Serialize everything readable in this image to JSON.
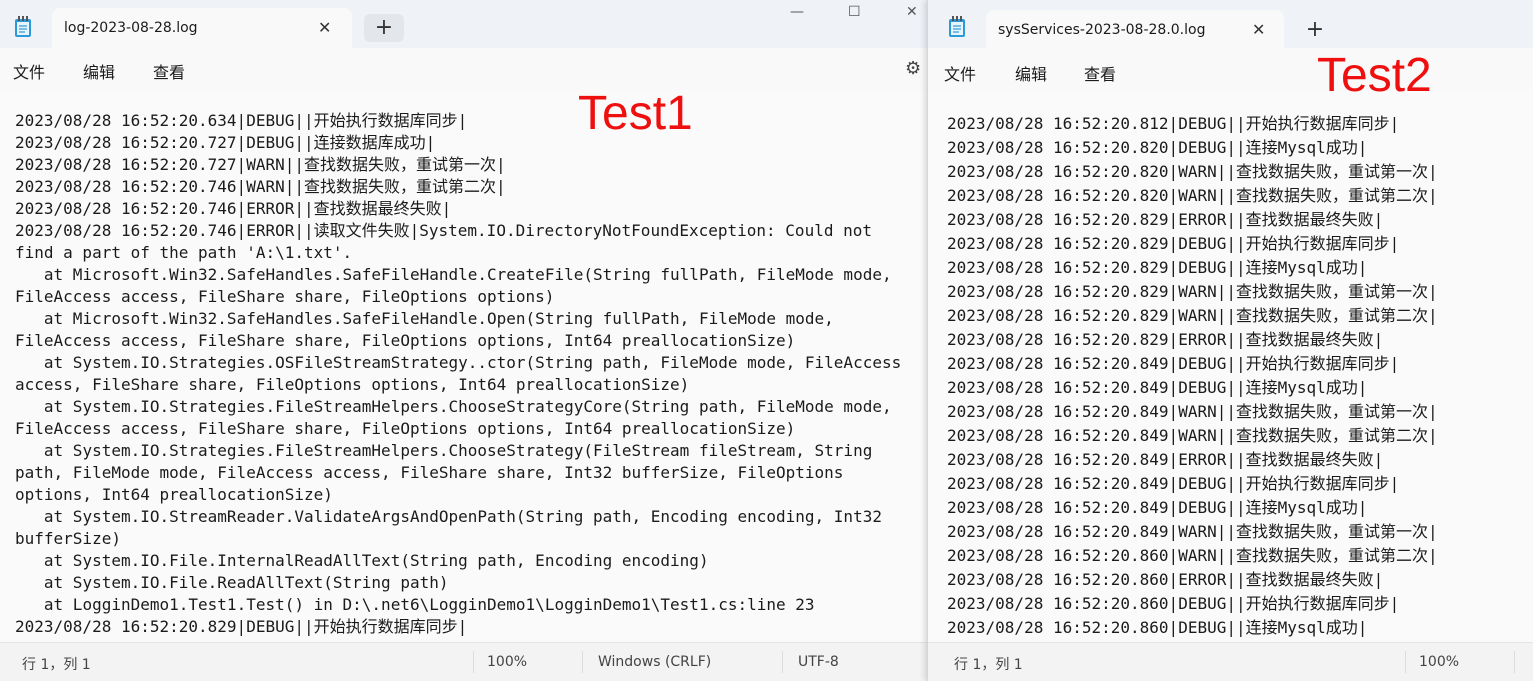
{
  "left_window": {
    "tab_title": "log-2023-08-28.log",
    "new_tab_label": "+",
    "close_tab_label": "✕",
    "caption": {
      "minimize": "—",
      "maximize": "☐",
      "close": "✕"
    },
    "menu": {
      "file": "文件",
      "edit": "编辑",
      "view": "查看"
    },
    "settings_icon": "⚙",
    "lines": [
      "2023/08/28 16:52:20.634|DEBUG||开始执行数据库同步|",
      "2023/08/28 16:52:20.727|DEBUG||连接数据库成功|",
      "2023/08/28 16:52:20.727|WARN||查找数据失败，重试第一次|",
      "2023/08/28 16:52:20.746|WARN||查找数据失败，重试第二次|",
      "2023/08/28 16:52:20.746|ERROR||查找数据最终失败|",
      "2023/08/28 16:52:20.746|ERROR||读取文件失败|System.IO.DirectoryNotFoundException: Could not find a part of the path 'A:\\1.txt'.",
      "   at Microsoft.Win32.SafeHandles.SafeFileHandle.CreateFile(String fullPath, FileMode mode, FileAccess access, FileShare share, FileOptions options)",
      "   at Microsoft.Win32.SafeHandles.SafeFileHandle.Open(String fullPath, FileMode mode, FileAccess access, FileShare share, FileOptions options, Int64 preallocationSize)",
      "   at System.IO.Strategies.OSFileStreamStrategy..ctor(String path, FileMode mode, FileAccess access, FileShare share, FileOptions options, Int64 preallocationSize)",
      "   at System.IO.Strategies.FileStreamHelpers.ChooseStrategyCore(String path, FileMode mode, FileAccess access, FileShare share, FileOptions options, Int64 preallocationSize)",
      "   at System.IO.Strategies.FileStreamHelpers.ChooseStrategy(FileStream fileStream, String path, FileMode mode, FileAccess access, FileShare share, Int32 bufferSize, FileOptions options, Int64 preallocationSize)",
      "   at System.IO.StreamReader.ValidateArgsAndOpenPath(String path, Encoding encoding, Int32 bufferSize)",
      "   at System.IO.File.InternalReadAllText(String path, Encoding encoding)",
      "   at System.IO.File.ReadAllText(String path)",
      "   at LogginDemo1.Test1.Test() in D:\\.net6\\LogginDemo1\\LogginDemo1\\Test1.cs:line 23",
      "2023/08/28 16:52:20.829|DEBUG||开始执行数据库同步|"
    ],
    "status": {
      "position": "行 1，列 1",
      "zoom": "100%",
      "line_ending": "Windows (CRLF)",
      "encoding": "UTF-8"
    },
    "annotation": "Test1"
  },
  "right_window": {
    "tab_title": "sysServices-2023-08-28.0.log",
    "new_tab_label": "+",
    "close_tab_label": "✕",
    "menu": {
      "file": "文件",
      "edit": "编辑",
      "view": "查看"
    },
    "lines": [
      "2023/08/28 16:52:20.812|DEBUG||开始执行数据库同步|",
      "2023/08/28 16:52:20.820|DEBUG||连接Mysql成功|",
      "2023/08/28 16:52:20.820|WARN||查找数据失败，重试第一次|",
      "2023/08/28 16:52:20.820|WARN||查找数据失败，重试第二次|",
      "2023/08/28 16:52:20.829|ERROR||查找数据最终失败|",
      "2023/08/28 16:52:20.829|DEBUG||开始执行数据库同步|",
      "2023/08/28 16:52:20.829|DEBUG||连接Mysql成功|",
      "2023/08/28 16:52:20.829|WARN||查找数据失败，重试第一次|",
      "2023/08/28 16:52:20.829|WARN||查找数据失败，重试第二次|",
      "2023/08/28 16:52:20.829|ERROR||查找数据最终失败|",
      "2023/08/28 16:52:20.849|DEBUG||开始执行数据库同步|",
      "2023/08/28 16:52:20.849|DEBUG||连接Mysql成功|",
      "2023/08/28 16:52:20.849|WARN||查找数据失败，重试第一次|",
      "2023/08/28 16:52:20.849|WARN||查找数据失败，重试第二次|",
      "2023/08/28 16:52:20.849|ERROR||查找数据最终失败|",
      "2023/08/28 16:52:20.849|DEBUG||开始执行数据库同步|",
      "2023/08/28 16:52:20.849|DEBUG||连接Mysql成功|",
      "2023/08/28 16:52:20.849|WARN||查找数据失败，重试第一次|",
      "2023/08/28 16:52:20.860|WARN||查找数据失败，重试第二次|",
      "2023/08/28 16:52:20.860|ERROR||查找数据最终失败|",
      "2023/08/28 16:52:20.860|DEBUG||开始执行数据库同步|",
      "2023/08/28 16:52:20.860|DEBUG||连接Mysql成功|"
    ],
    "status": {
      "position": "行 1，列 1",
      "zoom": "100%"
    },
    "annotation": "Test2"
  }
}
